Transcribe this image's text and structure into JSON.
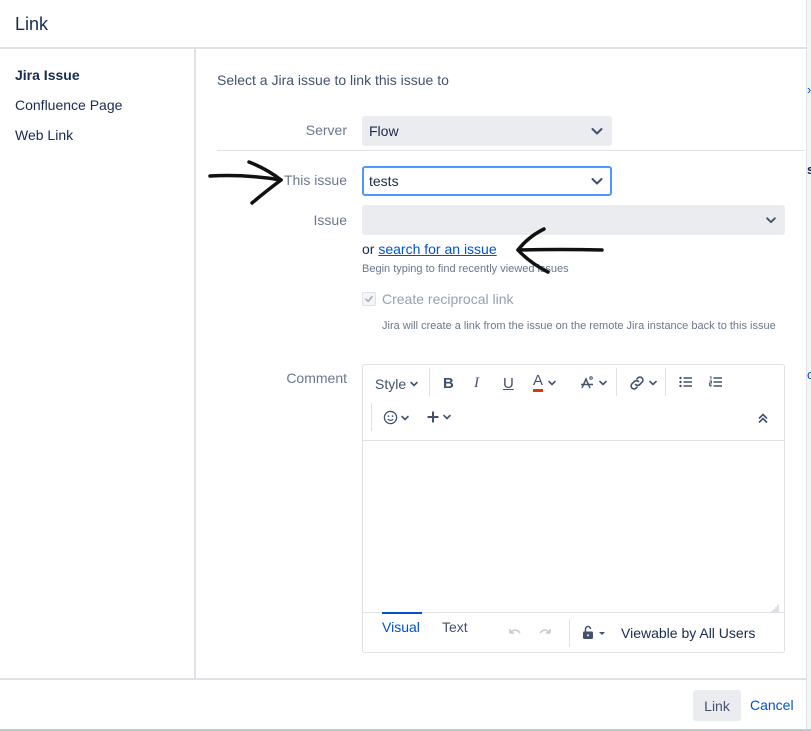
{
  "dialog": {
    "title": "Link"
  },
  "nav": {
    "items": [
      {
        "label": "Jira Issue",
        "active": true
      },
      {
        "label": "Confluence Page",
        "active": false
      },
      {
        "label": "Web Link",
        "active": false
      }
    ]
  },
  "form": {
    "intro": "Select a Jira issue to link this issue to",
    "server": {
      "label": "Server",
      "value": "Flow"
    },
    "this_issue": {
      "label": "This issue",
      "value": "tests"
    },
    "issue": {
      "label": "Issue",
      "value": ""
    },
    "search": {
      "prefix": "or",
      "link_text": "search for an issue"
    },
    "hint": "Begin typing to find recently viewed issues",
    "reciprocal": {
      "label": "Create reciprocal link",
      "checked": true,
      "description": "Jira will create a link from the issue on the remote Jira instance back to this issue"
    },
    "comment": {
      "label": "Comment",
      "toolbar": {
        "style_label": "Style",
        "icons": [
          "bold-icon",
          "italic-icon",
          "underline-icon",
          "text-color-icon",
          "text-formatting-icon",
          "link-icon",
          "bullet-list-icon",
          "numbered-list-icon",
          "emoji-icon",
          "insert-plus-icon",
          "collapse-toolbar-icon"
        ]
      },
      "tabs": [
        {
          "label": "Visual",
          "active": true
        },
        {
          "label": "Text",
          "active": false
        }
      ],
      "visibility": "Viewable by All Users"
    }
  },
  "footer": {
    "link_button": "Link",
    "cancel_button": "Cancel"
  },
  "colors": {
    "accent": "#0052cc",
    "focus": "#4c9aff",
    "text_color_underline": "#de350b"
  }
}
